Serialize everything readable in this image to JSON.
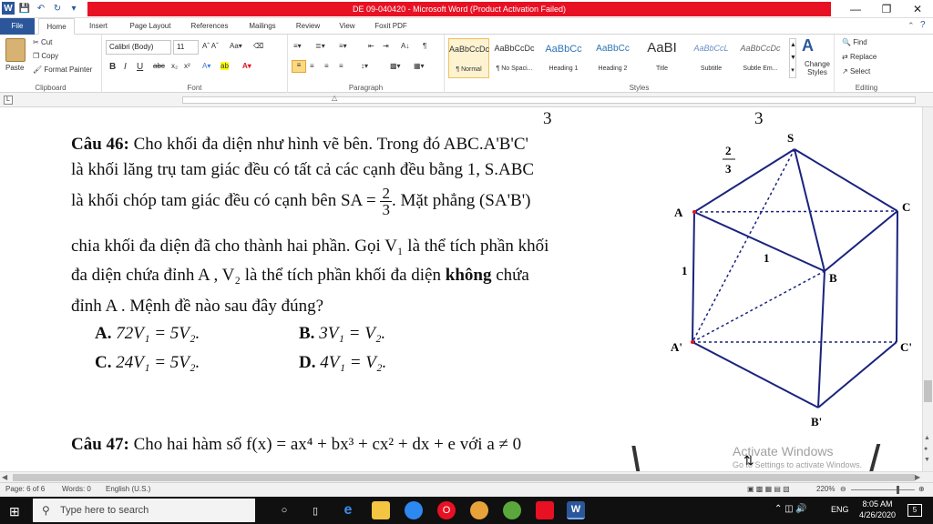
{
  "window": {
    "title": "DE 09-040420  -  Microsoft Word (Product Activation Failed)"
  },
  "tabs": [
    "File",
    "Home",
    "Insert",
    "Page Layout",
    "References",
    "Mailings",
    "Review",
    "View",
    "Foxit PDF"
  ],
  "ribbon": {
    "clipboard": {
      "label": "Clipboard",
      "paste": "Paste",
      "cut": "Cut",
      "copy": "Copy",
      "format_painter": "Format Painter"
    },
    "font": {
      "label": "Font",
      "name": "Calibri (Body)",
      "size": "11"
    },
    "paragraph": {
      "label": "Paragraph"
    },
    "styles": {
      "label": "Styles",
      "items": [
        {
          "sample": "AaBbCcDc",
          "name": "¶ Normal"
        },
        {
          "sample": "AaBbCcDc",
          "name": "¶ No Spaci..."
        },
        {
          "sample": "AaBbCc",
          "name": "Heading 1"
        },
        {
          "sample": "AaBbCc",
          "name": "Heading 2"
        },
        {
          "sample": "AaBI",
          "name": "Title"
        },
        {
          "sample": "AaBbCcL",
          "name": "Subtitle"
        },
        {
          "sample": "AaBbCcDc",
          "name": "Subtle Em..."
        }
      ],
      "change_styles": "Change Styles"
    },
    "editing": {
      "label": "Editing",
      "find": "Find",
      "replace": "Replace",
      "select": "Select"
    }
  },
  "document": {
    "top_partial": "3",
    "top_partial2": "3",
    "q46": {
      "label": "Câu 46:",
      "line1": "Cho khối đa diện như hình vẽ bên.  Trong đó ABC.A'B'C'",
      "line2": "là khối lăng trụ tam giác đều có tất cả các cạnh đều bằng 1,  S.ABC",
      "line3a": "là khối chóp tam giác đều có cạnh bên  SA =",
      "frac_num": "2",
      "frac_den": "3",
      "line3b": ". Mặt phẳng (SA'B')",
      "line4": "chia khối đa diện đã cho thành hai phần. Gọi  V₁  là thể tích phần khối",
      "line5a": "đa diện chứa đỉnh  A ,  V₂  là thể tích phần khối đa diện",
      "line5bold": "không",
      "line5b": "chứa",
      "line6": "đỉnh  A .  Mệnh đề nào sau đây đúng?",
      "options": [
        {
          "key": "A.",
          "text": "72V₁ = 5V₂."
        },
        {
          "key": "B.",
          "text": "3V₁ = V₂."
        },
        {
          "key": "C.",
          "text": "24V₁ = 5V₂."
        },
        {
          "key": "D.",
          "text": "4V₁ = V₂."
        }
      ]
    },
    "q47": {
      "label": "Câu 47:",
      "text": "Cho hai hàm số  f(x) = ax⁴ + bx³ + cx² + dx + e  với  a ≠ 0"
    },
    "figure": {
      "labels": {
        "S": "S",
        "A": "A",
        "B": "B",
        "C": "C",
        "A1": "A'",
        "B1": "B'",
        "C1": "C'",
        "edge1": "1",
        "edge1b": "1",
        "sa_num": "2",
        "sa_den": "3"
      }
    },
    "watermark": {
      "line1": "Activate Windows",
      "line2": "Go to Settings to activate Windows."
    }
  },
  "statusbar": {
    "page": "Page: 6 of 6",
    "words": "Words: 0",
    "language": "English (U.S.)",
    "zoom": "220%"
  },
  "taskbar": {
    "search_placeholder": "Type here to search",
    "time": "8:05 AM",
    "date": "4/26/2020",
    "lang": "ENG",
    "notif_count": "5"
  }
}
